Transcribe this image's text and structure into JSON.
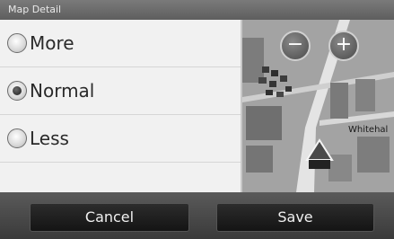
{
  "window": {
    "title": "Map Detail"
  },
  "options": [
    {
      "label": "More",
      "selected": false
    },
    {
      "label": "Normal",
      "selected": true
    },
    {
      "label": "Less",
      "selected": false
    }
  ],
  "map": {
    "zoom_out_label": "−",
    "zoom_in_label": "+",
    "street_label": "Whitehal"
  },
  "buttons": {
    "cancel_label": "Cancel",
    "save_label": "Save"
  }
}
